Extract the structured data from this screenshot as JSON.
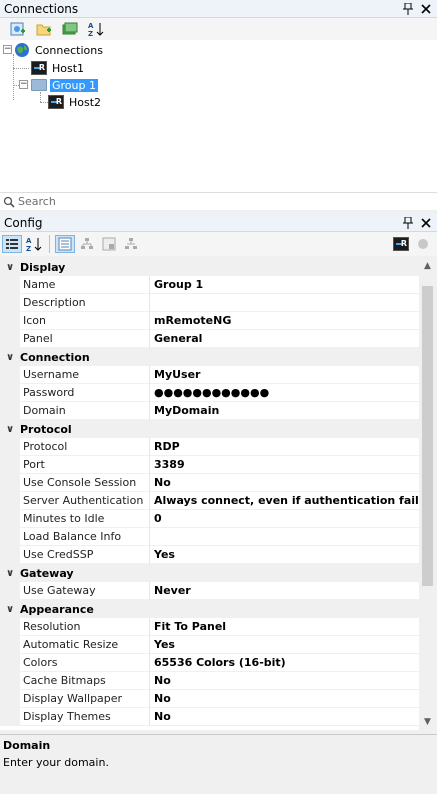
{
  "connections_panel": {
    "title": "Connections",
    "pin_icon": "pin-icon",
    "close_icon": "close-icon",
    "toolbar": [
      "new-connection-icon",
      "new-folder-icon",
      "view-icon",
      "sort-az-icon"
    ],
    "tree": {
      "root": "Connections",
      "host1": "Host1",
      "group1": "Group 1",
      "host2": "Host2"
    },
    "search_placeholder": "Search"
  },
  "config_panel": {
    "title": "Config",
    "pin_icon": "pin-icon",
    "close_icon": "close-icon",
    "toolbar": [
      "categorized-icon",
      "alphabetical-icon",
      "properties-icon",
      "inheritance-icon",
      "default-properties-icon",
      "default-inheritance-icon"
    ]
  },
  "grid": {
    "categories": [
      {
        "name": "Display",
        "props": [
          {
            "name": "Name",
            "value": "Group 1"
          },
          {
            "name": "Description",
            "value": ""
          },
          {
            "name": "Icon",
            "value": "mRemoteNG"
          },
          {
            "name": "Panel",
            "value": "General"
          }
        ]
      },
      {
        "name": "Connection",
        "props": [
          {
            "name": "Username",
            "value": "MyUser"
          },
          {
            "name": "Password",
            "value": "●●●●●●●●●●●●"
          },
          {
            "name": "Domain",
            "value": "MyDomain"
          }
        ]
      },
      {
        "name": "Protocol",
        "props": [
          {
            "name": "Protocol",
            "value": "RDP"
          },
          {
            "name": "Port",
            "value": "3389"
          },
          {
            "name": "Use Console Session",
            "value": "No"
          },
          {
            "name": "Server Authentication",
            "value": "Always connect, even if authentication fails"
          },
          {
            "name": "Minutes to Idle",
            "value": "0"
          },
          {
            "name": "Load Balance Info",
            "value": ""
          },
          {
            "name": "Use CredSSP",
            "value": "Yes"
          }
        ]
      },
      {
        "name": "Gateway",
        "props": [
          {
            "name": "Use Gateway",
            "value": "Never"
          }
        ]
      },
      {
        "name": "Appearance",
        "props": [
          {
            "name": "Resolution",
            "value": "Fit To Panel"
          },
          {
            "name": "Automatic Resize",
            "value": "Yes"
          },
          {
            "name": "Colors",
            "value": "65536 Colors (16-bit)"
          },
          {
            "name": "Cache Bitmaps",
            "value": "No"
          },
          {
            "name": "Display Wallpaper",
            "value": "No"
          },
          {
            "name": "Display Themes",
            "value": "No"
          }
        ]
      }
    ]
  },
  "help": {
    "title": "Domain",
    "description": "Enter your domain."
  }
}
